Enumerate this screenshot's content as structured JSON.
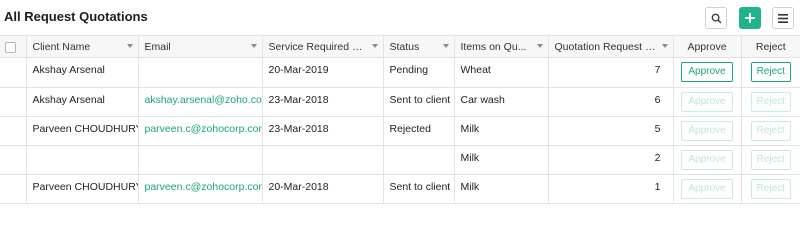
{
  "page": {
    "title": "All Request Quotations"
  },
  "toolbar": {
    "search_icon": "search-icon",
    "add_icon": "plus-icon",
    "menu_icon": "hamburger-menu-icon",
    "accent_color": "#1fb58c"
  },
  "table": {
    "headers": {
      "client": "Client Name",
      "email": "Email",
      "service": "Service Required bef...",
      "status": "Status",
      "items": "Items on Qu...",
      "qnum": "Quotation Request Nu...",
      "approve": "Approve",
      "reject": "Reject"
    },
    "rows": [
      {
        "client": "Akshay Arsenal",
        "email": "",
        "service": "20-Mar-2019",
        "status": "Pending",
        "items": "Wheat",
        "qnum": "7",
        "approve": "Approve",
        "reject": "Reject",
        "enabled": true
      },
      {
        "client": "Akshay Arsenal",
        "email": "akshay.arsenal@zoho.com",
        "service": "23-Mar-2018",
        "status": "Sent to client",
        "items": "Car wash",
        "qnum": "6",
        "approve": "Approve",
        "reject": "Reject",
        "enabled": false
      },
      {
        "client": "Parveen CHOUDHURY",
        "email": "parveen.c@zohocorp.com",
        "service": "23-Mar-2018",
        "status": "Rejected",
        "items": "Milk",
        "qnum": "5",
        "approve": "Approve",
        "reject": "Reject",
        "enabled": false
      },
      {
        "client": "",
        "email": "",
        "service": "",
        "status": "",
        "items": "Milk",
        "qnum": "2",
        "approve": "Approve",
        "reject": "Reject",
        "enabled": false
      },
      {
        "client": "Parveen CHOUDHURY",
        "email": "parveen.c@zohocorp.com",
        "service": "20-Mar-2018",
        "status": "Sent to client",
        "items": "Milk",
        "qnum": "1",
        "approve": "Approve",
        "reject": "Reject",
        "enabled": false
      }
    ]
  }
}
